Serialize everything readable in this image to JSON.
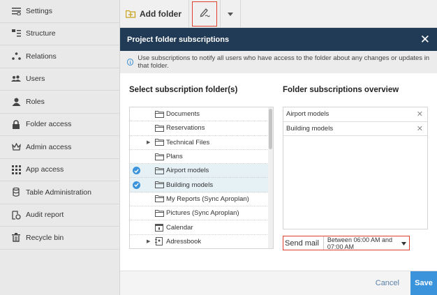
{
  "sidebar": {
    "items": [
      {
        "label": "Settings",
        "icon": "settings-icon"
      },
      {
        "label": "Structure",
        "icon": "structure-icon"
      },
      {
        "label": "Relations",
        "icon": "relations-icon"
      },
      {
        "label": "Users",
        "icon": "users-icon"
      },
      {
        "label": "Roles",
        "icon": "roles-icon"
      },
      {
        "label": "Folder access",
        "icon": "lock-icon"
      },
      {
        "label": "Admin access",
        "icon": "crown-icon"
      },
      {
        "label": "App access",
        "icon": "grid-icon"
      },
      {
        "label": "Table Administration",
        "icon": "database-icon"
      },
      {
        "label": "Audit report",
        "icon": "audit-icon"
      },
      {
        "label": "Recycle bin",
        "icon": "trash-icon"
      }
    ]
  },
  "toolbar": {
    "add_folder_label": "Add folder"
  },
  "modal": {
    "title": "Project folder subscriptions",
    "info_text": "Use subscriptions to notify all users who have access to the folder about any changes or updates in that folder.",
    "left_title": "Select subscription folder(s)",
    "right_title": "Folder subscriptions overview",
    "tree": [
      {
        "label": "Documents",
        "selected": false,
        "expandable": false
      },
      {
        "label": "Reservations",
        "selected": false,
        "expandable": false
      },
      {
        "label": "Technical Files",
        "selected": false,
        "expandable": true
      },
      {
        "label": "Plans",
        "selected": false,
        "expandable": false
      },
      {
        "label": "Airport models",
        "selected": true,
        "expandable": false
      },
      {
        "label": "Building models",
        "selected": true,
        "expandable": false
      },
      {
        "label": "My Reports (Sync Aproplan)",
        "selected": false,
        "expandable": false
      },
      {
        "label": "Pictures (Sync Aproplan)",
        "selected": false,
        "expandable": false
      },
      {
        "label": "Calendar",
        "selected": false,
        "expandable": false
      },
      {
        "label": "Adressbook",
        "selected": false,
        "expandable": true
      }
    ],
    "overview": [
      {
        "label": "Airport models"
      },
      {
        "label": "Building models"
      }
    ],
    "send_mail_label": "Send mail",
    "send_mail_value": "Between 06:00 AM and 07:00 AM",
    "cancel_label": "Cancel",
    "save_label": "Save"
  },
  "colors": {
    "header": "#213a56",
    "accent": "#3b93db",
    "highlight": "#e0412e"
  }
}
